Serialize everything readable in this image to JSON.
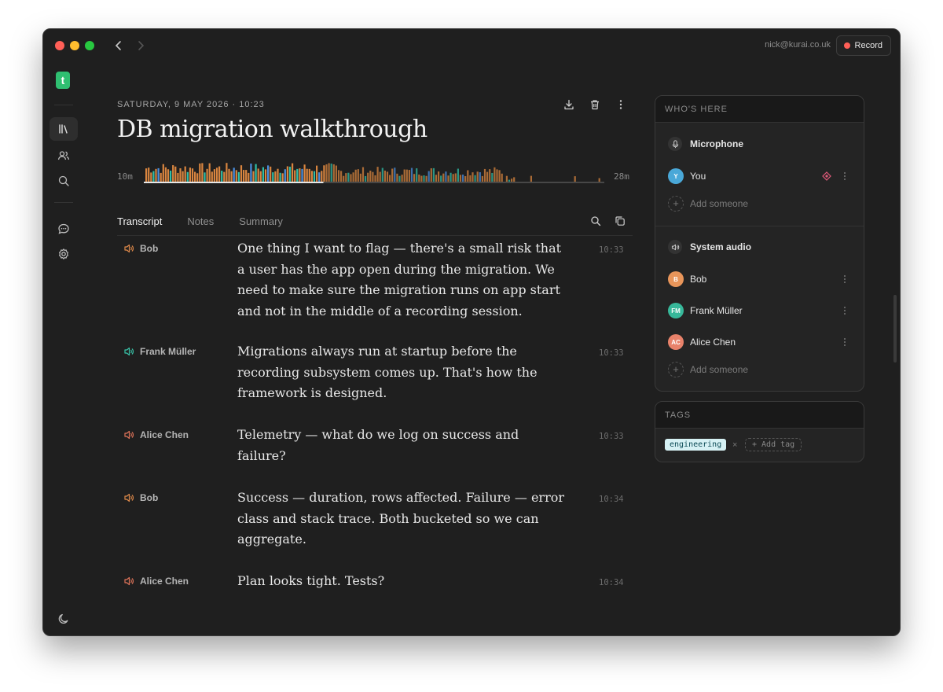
{
  "titlebar": {
    "account": "nick@kurai.co.uk",
    "record_label": "Record"
  },
  "sidebar": {
    "logo_letter": "t",
    "items": [
      {
        "name": "library",
        "icon": "library-icon",
        "active": true
      },
      {
        "name": "people",
        "icon": "people-icon",
        "active": false
      },
      {
        "name": "search",
        "icon": "search-icon",
        "active": false
      },
      {
        "name": "chat",
        "icon": "chat-icon",
        "active": false
      },
      {
        "name": "settings",
        "icon": "gear-icon",
        "active": false
      },
      {
        "name": "theme",
        "icon": "moon-icon",
        "active": false
      }
    ]
  },
  "meeting": {
    "date": "SATURDAY, 9 MAY 2026 · 10:23",
    "title": "DB migration walkthrough",
    "actions": [
      "download-icon",
      "trash-icon",
      "more-vertical-icon"
    ]
  },
  "waveform": {
    "start_label": "10m",
    "end_label": "28m",
    "playback_progress": 0.39,
    "colors": {
      "speaker_a": "#d9853f",
      "speaker_b": "#2fbfa8",
      "speaker_c": "#4a8fe0",
      "played_line": "#e6e6e6",
      "unplayed_line": "#555555"
    }
  },
  "tabs": [
    {
      "label": "Transcript",
      "active": true
    },
    {
      "label": "Notes",
      "active": false
    },
    {
      "label": "Summary",
      "active": false
    }
  ],
  "transcript": [
    {
      "speaker": "Bob",
      "speaker_color": "#e08a4a",
      "text": "One thing I want to flag — there's a small risk that a user has the app open during the migration. We need to make sure the migration runs on app start and not in the middle of a recording session.",
      "time": "10:33"
    },
    {
      "speaker": "Frank Müller",
      "speaker_color": "#39c5aa",
      "text": "Migrations always run at startup before the recording subsystem comes up. That's how the framework is designed.",
      "time": "10:33"
    },
    {
      "speaker": "Alice Chen",
      "speaker_color": "#e0745a",
      "text": "Telemetry — what do we log on success and failure?",
      "time": "10:33"
    },
    {
      "speaker": "Bob",
      "speaker_color": "#e08a4a",
      "text": "Success — duration, rows affected. Failure — error class and stack trace. Both bucketed so we can aggregate.",
      "time": "10:34"
    },
    {
      "speaker": "Alice Chen",
      "speaker_color": "#e0745a",
      "text": "Plan looks tight. Tests?",
      "time": "10:34"
    }
  ],
  "whos_here": {
    "heading": "WHO'S HERE",
    "microphone": {
      "label": "Microphone",
      "people": [
        {
          "initials": "Y",
          "name": "You",
          "color": "#4aa8d8"
        }
      ],
      "add_label": "Add someone"
    },
    "system_audio": {
      "label": "System audio",
      "people": [
        {
          "initials": "B",
          "name": "Bob",
          "color": "#e8955a"
        },
        {
          "initials": "FM",
          "name": "Frank Müller",
          "color": "#37b89a"
        },
        {
          "initials": "AC",
          "name": "Alice Chen",
          "color": "#e8826a"
        }
      ],
      "add_label": "Add someone"
    }
  },
  "tags": {
    "heading": "TAGS",
    "items": [
      "engineering"
    ],
    "add_label": "+ Add tag"
  }
}
